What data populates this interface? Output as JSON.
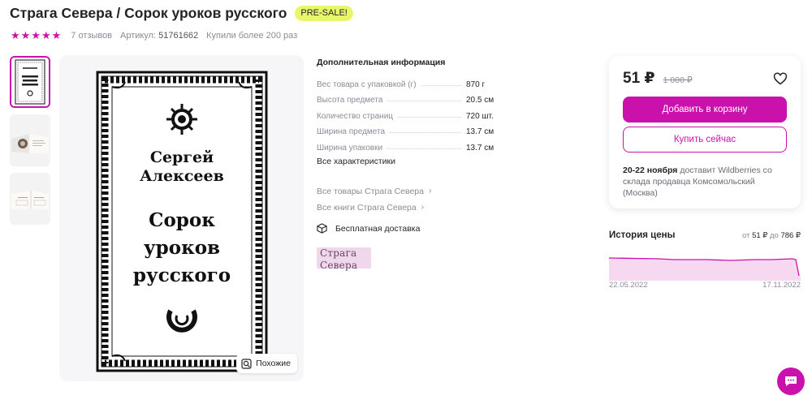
{
  "product": {
    "title": "Страга Севера / Сорок уроков русского",
    "badge": "PRE-SALE!",
    "rating_stars": 5,
    "reviews": "7 отзывов",
    "article_label": "Артикул:",
    "article_value": "51761662",
    "bought": "Купили более 200 раз"
  },
  "gallery": {
    "similar_label": "Похожие",
    "cover": {
      "author_line1": "Сергей",
      "author_line2": "Алексеев",
      "title_line1": "Сорок",
      "title_line2": "уроков",
      "title_line3": "русского"
    }
  },
  "info": {
    "heading": "Дополнительная информация",
    "characteristics": [
      {
        "name": "Вес товара с упаковкой (г)",
        "value": "870 г"
      },
      {
        "name": "Высота предмета",
        "value": "20.5 см"
      },
      {
        "name": "Количество страниц",
        "value": "720 шт."
      },
      {
        "name": "Ширина предмета",
        "value": "13.7 см"
      },
      {
        "name": "Ширина упаковки",
        "value": "13.7 см"
      }
    ],
    "all_characteristics": "Все характеристики",
    "all_goods_link": "Все товары Страга Севера",
    "all_books_link": "Все книги Страга Севера",
    "delivery": "Бесплатная доставка",
    "brand_logo_line1": "Страга",
    "brand_logo_line2": "Севера"
  },
  "buy": {
    "price": "51 ₽",
    "old_price": "1 000 ₽",
    "add_to_cart": "Добавить в корзину",
    "buy_now": "Купить сейчас",
    "delivery_date": "20-22 ноября",
    "delivery_rest": " доставит Wildberries со склада продавца Комсомольский (Москва)"
  },
  "history": {
    "title": "История цены",
    "range_from_label": "от",
    "range_from": "51 ₽",
    "range_to_label": "до",
    "range_to": "786 ₽",
    "date_start": "22.05.2022",
    "date_end": "17.11.2022"
  },
  "colors": {
    "accent": "#cb11ab",
    "badge": "#e8f76a",
    "history_fill": "#f6d9f0"
  }
}
